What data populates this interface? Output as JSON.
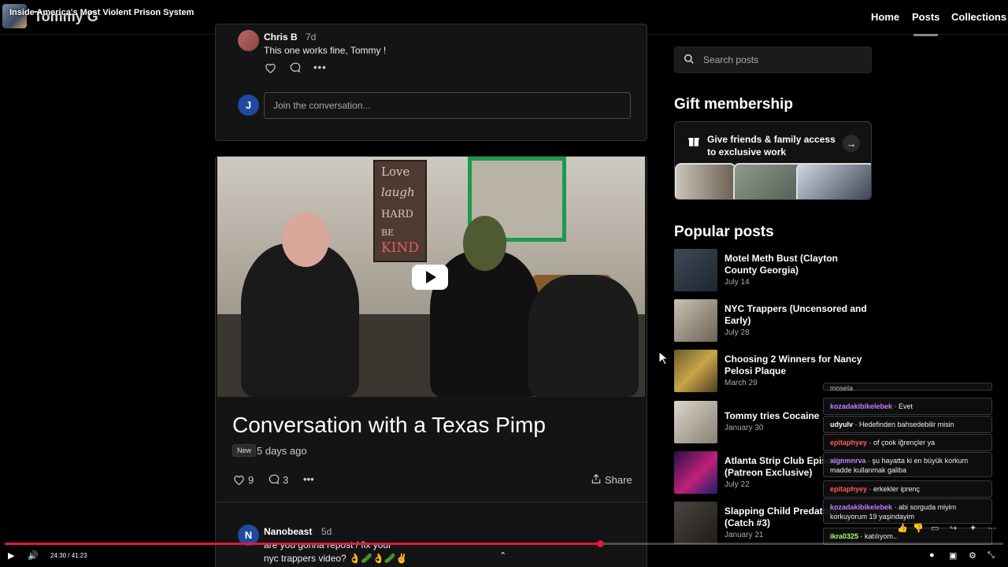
{
  "header": {
    "site_name": "Tommy G",
    "video_title": "Inside America's Most Violent Prison System",
    "nav": [
      "Home",
      "Posts",
      "Collections"
    ],
    "active_nav": "Posts"
  },
  "top_comment": {
    "author": "Chris B",
    "age": "7d",
    "text": "This one works fine, Tommy !",
    "join_avatar": "J",
    "join_placeholder": "Join the conversation..."
  },
  "post": {
    "title": "Conversation with a Texas Pimp",
    "badge": "New",
    "posted": "5 days ago",
    "likes": "9",
    "comments": "3",
    "share_label": "Share",
    "thumb_sign_words": [
      "Love",
      "laugh",
      "HARD",
      "BE",
      "KIND"
    ]
  },
  "bottom_comment": {
    "avatar": "N",
    "author": "Nanobeast",
    "age": "5d",
    "line1": "are you gonna repost / fix your",
    "line2": "nyc trappers video? 👌🥒👌🥒✌️"
  },
  "sidebar": {
    "search_placeholder": "Search posts",
    "gift_heading": "Gift membership",
    "gift_text": "Give friends & family access to exclusive work",
    "popular_heading": "Popular posts",
    "popular": [
      {
        "title": "Motel Meth Bust (Clayton County Georgia)",
        "date": "July 14"
      },
      {
        "title": "NYC Trappers (Uncensored and Early)",
        "date": "July 28"
      },
      {
        "title": "Choosing 2 Winners for Nancy Pelosi Plaque",
        "date": "March 29"
      },
      {
        "title": "Tommy tries Cocaine",
        "date": "January 30"
      },
      {
        "title": "Atlanta Strip Club Episode (Patreon Exclusive)",
        "date": "July 22"
      },
      {
        "title": "Slapping Child Predators (Catch #3)",
        "date": "January 21"
      }
    ]
  },
  "chat": [
    {
      "user": "",
      "text": "mosela",
      "color": "#bbbbbb"
    },
    {
      "user": "kozadakibikelebek",
      "text": "Evet",
      "color": "#c77dff"
    },
    {
      "user": "udyulv",
      "text": "Hedefinden bahsedebilir misin",
      "color": "#ffffff"
    },
    {
      "user": "epitaphyey",
      "text": "of çook iğrençler ya",
      "color": "#ff5a5a"
    },
    {
      "user": "aignmnrva",
      "text": "şu hayatta ki en büyük korkum madde kullanmak galiba",
      "color": "#c77dff"
    },
    {
      "user": "epitaphyey",
      "text": "erkekler iprenç",
      "color": "#ff5a5a"
    },
    {
      "user": "kozadakibikelebek",
      "text": "abi sorguda miyim korkuyorum 19 yaşindayim",
      "color": "#c77dff"
    },
    {
      "user": "ikra0325",
      "text": "katılıyom..",
      "color": "#a8ff60"
    }
  ],
  "player": {
    "time": "24:30 / 41:23",
    "progress": 0.5966
  },
  "colors": {
    "accent": "#e5173d",
    "background": "#000000"
  }
}
